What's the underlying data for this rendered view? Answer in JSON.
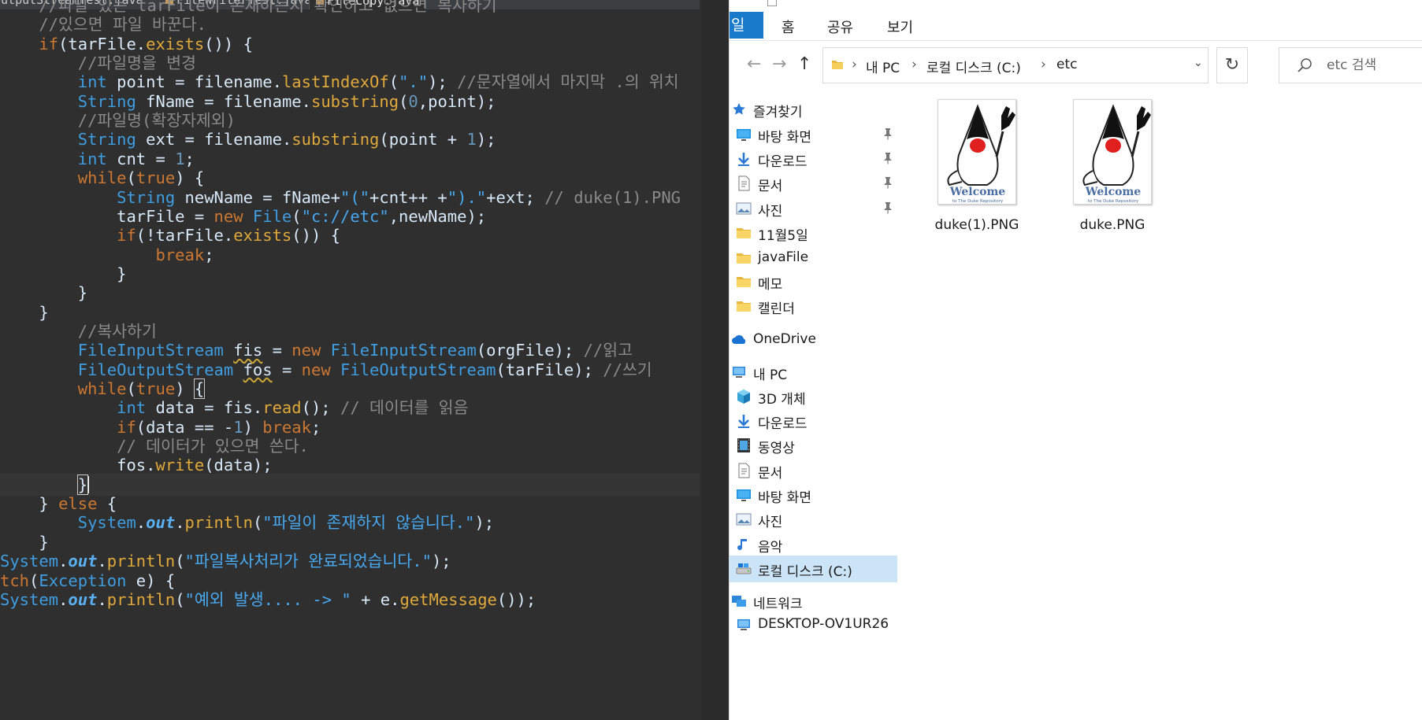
{
  "editor": {
    "tabs": [
      {
        "label": "OutputStreamTest.java",
        "active": false
      },
      {
        "label": "FileWriterTest.java",
        "active": false
      },
      {
        "label": "FileCopy.java",
        "active": true
      }
    ],
    "lines": [
      {
        "html": "    <span class='cmt'>//파일 있는 tarFile이 존재하는지 확인하고 없으면 복사하기</span>"
      },
      {
        "html": "    <span class='cmt'>//있으면 파일 바꾼다.</span>"
      },
      {
        "html": "    <span class='kw'>if</span>(tarFile.<span class='mth'>exists</span>()) {"
      },
      {
        "html": "        <span class='cmt'>//파일명을 변경</span>"
      },
      {
        "html": "        <span class='ty'>int</span> point = filename.<span class='mth'>lastIndexOf</span>(<span class='str'>\".\"</span>); <span class='cmt'>//문자열에서 마지막 .의 위치</span>"
      },
      {
        "html": "        <span class='ty'>String</span> fName = filename.<span class='mth'>substring</span>(<span class='num'>0</span>,point);"
      },
      {
        "html": "        <span class='cmt'>//파일명(확장자제외)</span>"
      },
      {
        "html": "        <span class='ty'>String</span> ext = filename.<span class='mth'>substring</span>(point + <span class='num'>1</span>);"
      },
      {
        "html": "        <span class='ty'>int</span> cnt = <span class='num'>1</span>;"
      },
      {
        "html": "        <span class='kw'>while</span>(<span class='kw'>true</span>) {"
      },
      {
        "html": "            <span class='ty'>String</span> newName = fName+<span class='str'>\"(\"</span>+cnt++ +<span class='str'>\").\"</span>+ext; <span class='cmt'>// duke(1).PNG</span>"
      },
      {
        "html": "            tarFile = <span class='kw'>new</span> <span class='ty'>File</span>(<span class='str'>\"c://etc\"</span>,newName);"
      },
      {
        "html": "            <span class='kw'>if</span>(!tarFile.<span class='mth'>exists</span>()) {"
      },
      {
        "html": "                <span class='kw'>break</span>;"
      },
      {
        "html": "            }"
      },
      {
        "html": "        }"
      },
      {
        "html": "    }"
      },
      {
        "html": "        <span class='cmt'>//복사하기</span>"
      },
      {
        "html": "        <span class='ty'>FileInputStream</span> <span class='sq'>fis</span> = <span class='kw'>new</span> <span class='ty'>FileInputStream</span>(orgFile); <span class='cmt'>//읽고</span>"
      },
      {
        "html": "        <span class='ty'>FileOutputStream</span> <span class='sq'>fos</span> = <span class='kw'>new</span> <span class='ty'>FileOutputStream</span>(tarFile); <span class='cmt'>//쓰기</span>"
      },
      {
        "html": "        <span class='kw'>while</span>(<span class='kw'>true</span>) <span class='brk'>{</span>"
      },
      {
        "html": "            <span class='ty'>int</span> data = fis.<span class='mth'>read</span>(); <span class='cmt'>// 데이터를 읽음</span>"
      },
      {
        "html": "            <span class='kw'>if</span>(data == -<span class='num'>1</span>) <span class='kw'>break</span>;"
      },
      {
        "html": "            <span class='cmt'>// 데이터가 있으면 쓴다.</span>"
      },
      {
        "html": "            fos.<span class='mth'>write</span>(data);"
      },
      {
        "html": "        <span class='brk'>}</span><span class='caret'></span>",
        "current": true
      },
      {
        "html": "    } <span class='kw'>else</span> {"
      },
      {
        "html": "        <span class='ty'>System</span>.<span class='sfd'>out</span>.<span class='mth'>println</span>(<span class='str'>\"파일이 존재하지 않습니다.\"</span>);"
      },
      {
        "html": "    }"
      },
      {
        "html": "<span class='ty'>System</span>.<span class='sfd'>out</span>.<span class='mth'>println</span>(<span class='str'>\"파일복사처리가 완료되었습니다.\"</span>);"
      },
      {
        "html": "<span class='kw'>tch</span>(<span class='ty'>Exception</span> e) {"
      },
      {
        "html": "<span class='ty'>System</span>.<span class='sfd'>out</span>.<span class='mth'>println</span>(<span class='str'>\"예외 발생.... -&gt; \"</span> + e.<span class='mth'>getMessage</span>());"
      }
    ]
  },
  "explorer": {
    "ribbon": {
      "file_tab": "일",
      "tabs": [
        "홈",
        "공유",
        "보기"
      ]
    },
    "nav_buttons": {
      "back": "←",
      "forward": "→",
      "up": "↑"
    },
    "address": {
      "crumbs": [
        "내 PC",
        "로컬 디스크 (C:)",
        "etc"
      ],
      "separator": "›",
      "dropdown": "⌄"
    },
    "refresh": "↻",
    "search": {
      "placeholder": "etc 검색"
    },
    "nav_items": [
      {
        "label": "즐겨찾기",
        "icon": "star-icon",
        "group": true,
        "pinned": false
      },
      {
        "label": "바탕 화면",
        "icon": "desktop-icon",
        "pinned": true
      },
      {
        "label": "다운로드",
        "icon": "download-icon",
        "pinned": true
      },
      {
        "label": "문서",
        "icon": "document-icon",
        "pinned": true
      },
      {
        "label": "사진",
        "icon": "pictures-icon",
        "pinned": true
      },
      {
        "label": "11월5일",
        "icon": "folder-icon",
        "pinned": false
      },
      {
        "label": "javaFile",
        "icon": "folder-icon",
        "pinned": false
      },
      {
        "label": "메모",
        "icon": "folder-icon",
        "pinned": false
      },
      {
        "label": "캘린더",
        "icon": "folder-icon",
        "pinned": false
      },
      {
        "label": "OneDrive",
        "icon": "cloud-icon",
        "group": true,
        "pinned": false
      },
      {
        "label": "내 PC",
        "icon": "computer-icon",
        "group": true,
        "pinned": false
      },
      {
        "label": "3D 개체",
        "icon": "cube-icon",
        "pinned": false
      },
      {
        "label": "다운로드",
        "icon": "download-icon",
        "pinned": false
      },
      {
        "label": "동영상",
        "icon": "video-icon",
        "pinned": false
      },
      {
        "label": "문서",
        "icon": "document-icon",
        "pinned": false
      },
      {
        "label": "바탕 화면",
        "icon": "desktop-icon",
        "pinned": false
      },
      {
        "label": "사진",
        "icon": "pictures-icon",
        "pinned": false
      },
      {
        "label": "음악",
        "icon": "music-icon",
        "pinned": false
      },
      {
        "label": "로컬 디스크 (C:)",
        "icon": "drive-icon",
        "pinned": false,
        "selected": true
      },
      {
        "label": "네트워크",
        "icon": "network-icon",
        "group": true,
        "pinned": false
      },
      {
        "label": "DESKTOP-OV1UR26",
        "icon": "computer-icon",
        "pinned": false
      }
    ],
    "files": [
      {
        "name": "duke(1).PNG",
        "thumb_text": "Welcome",
        "thumb_subtext": "to The Duke Repository"
      },
      {
        "name": "duke.PNG",
        "thumb_text": "Welcome",
        "thumb_subtext": "to The Duke Repository"
      }
    ]
  },
  "colors": {
    "editor_bg": "#2f2f2f",
    "keyword": "#cc7832",
    "type": "#3f9de0",
    "string": "#48a8f0",
    "comment": "#8a8a8a",
    "explorer_accent": "#1979ca",
    "nav_selected": "#cce4f7"
  }
}
